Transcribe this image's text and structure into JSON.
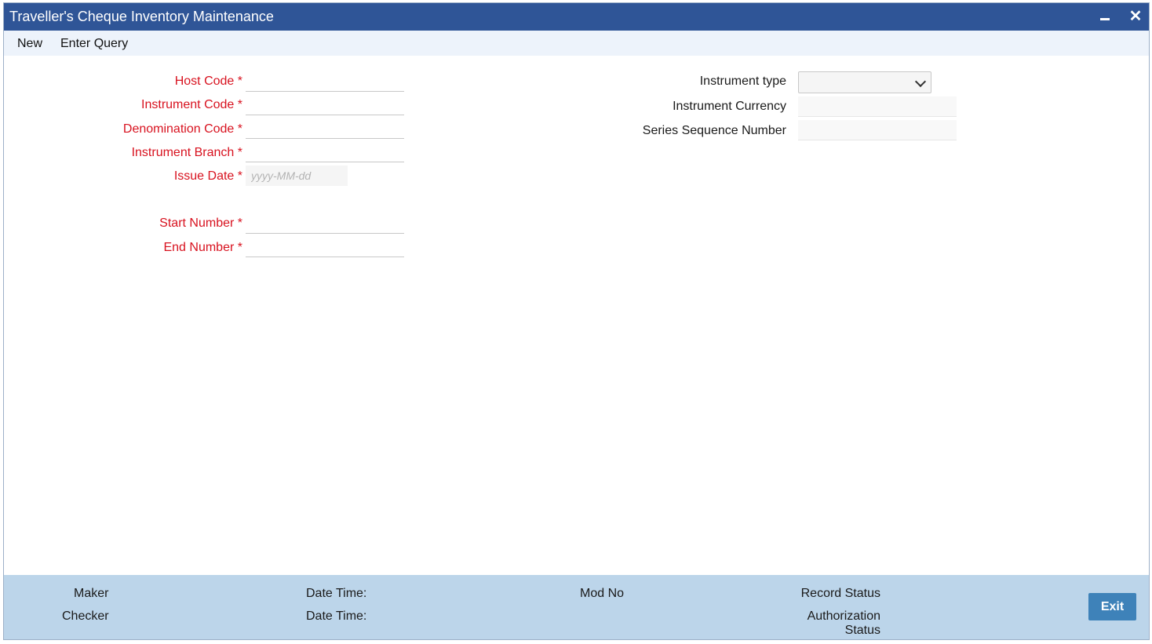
{
  "window": {
    "title": "Traveller's Cheque Inventory Maintenance",
    "close_glyph": "✕"
  },
  "toolbar": {
    "new_label": "New",
    "enter_query_label": "Enter Query"
  },
  "form_left": {
    "host_code": {
      "label": "Host Code",
      "required_mark": "*",
      "value": ""
    },
    "instrument_code": {
      "label": "Instrument Code",
      "required_mark": "*",
      "value": ""
    },
    "denomination_code": {
      "label": "Denomination Code",
      "required_mark": "*",
      "value": ""
    },
    "instrument_branch": {
      "label": "Instrument Branch",
      "required_mark": "*",
      "value": ""
    },
    "issue_date": {
      "label": "Issue Date",
      "required_mark": "*",
      "value": "",
      "placeholder": "yyyy-MM-dd"
    },
    "start_number": {
      "label": "Start Number",
      "required_mark": "*",
      "value": ""
    },
    "end_number": {
      "label": "End Number",
      "required_mark": "*",
      "value": ""
    }
  },
  "form_right": {
    "instrument_type": {
      "label": "Instrument type",
      "selected": ""
    },
    "instrument_currency": {
      "label": "Instrument Currency",
      "value": ""
    },
    "series_sequence_number": {
      "label": "Series Sequence Number",
      "value": ""
    }
  },
  "footer": {
    "maker_label": "Maker",
    "checker_label": "Checker",
    "date_time_label_1": "Date Time:",
    "date_time_label_2": "Date Time:",
    "mod_no_label": "Mod No",
    "record_status_label": "Record Status",
    "authorization_label_line1": "Authorization",
    "authorization_label_line2": "Status",
    "exit_label": "Exit"
  },
  "colors": {
    "titlebar": "#2f5597",
    "required_label": "#d8121f",
    "footer": "#bcd5ea",
    "exit_button": "#3e82b9"
  },
  "icons": [
    "minimize-icon",
    "close-icon",
    "chevron-down-icon"
  ]
}
